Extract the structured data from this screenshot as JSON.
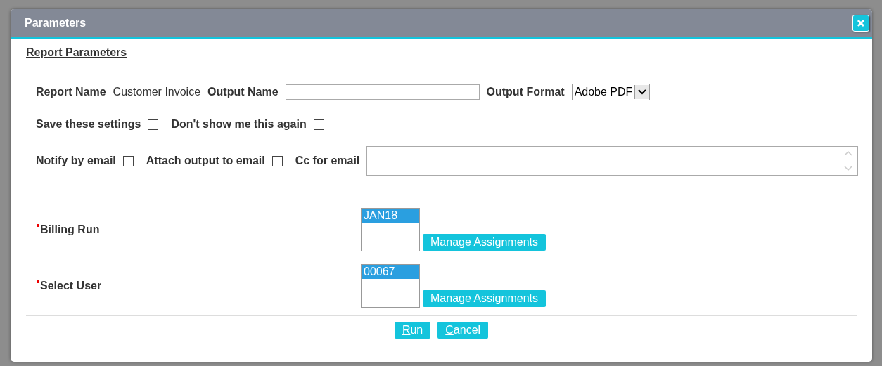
{
  "window": {
    "title": "Parameters"
  },
  "section_title": "Report Parameters",
  "rows": [
    [
      {
        "kind": "label",
        "text": "Report Name"
      },
      {
        "kind": "value",
        "text": "Customer Invoice"
      },
      {
        "kind": "label",
        "text": "Output Name"
      },
      {
        "kind": "input"
      },
      {
        "kind": "label",
        "text": "Output Format"
      },
      {
        "kind": "select",
        "value": "Adobe PDF"
      }
    ],
    [
      {
        "kind": "label",
        "text": "Save these settings"
      },
      {
        "kind": "checkbox",
        "checked": false
      },
      {
        "kind": "label",
        "text": "Don't show me this again"
      },
      {
        "kind": "checkbox",
        "checked": false
      }
    ],
    [
      {
        "kind": "label",
        "text": "Notify by email"
      },
      {
        "kind": "checkbox",
        "checked": false
      },
      {
        "kind": "label",
        "text": "Attach output to email"
      },
      {
        "kind": "checkbox",
        "checked": false
      },
      {
        "kind": "label",
        "text": "Cc for email"
      },
      {
        "kind": "textarea"
      }
    ]
  ],
  "parameters": [
    {
      "label": "Billing Run",
      "required": true,
      "options": [
        {
          "text": "JAN18",
          "selected": true
        }
      ],
      "button": "Manage Assignments"
    },
    {
      "label": "Select User",
      "required": true,
      "options": [
        {
          "text": "00067",
          "selected": true
        }
      ],
      "button": "Manage Assignments"
    }
  ],
  "buttons": [
    {
      "accel": "R",
      "rest": "un"
    },
    {
      "accel": "C",
      "rest": "ancel"
    }
  ]
}
